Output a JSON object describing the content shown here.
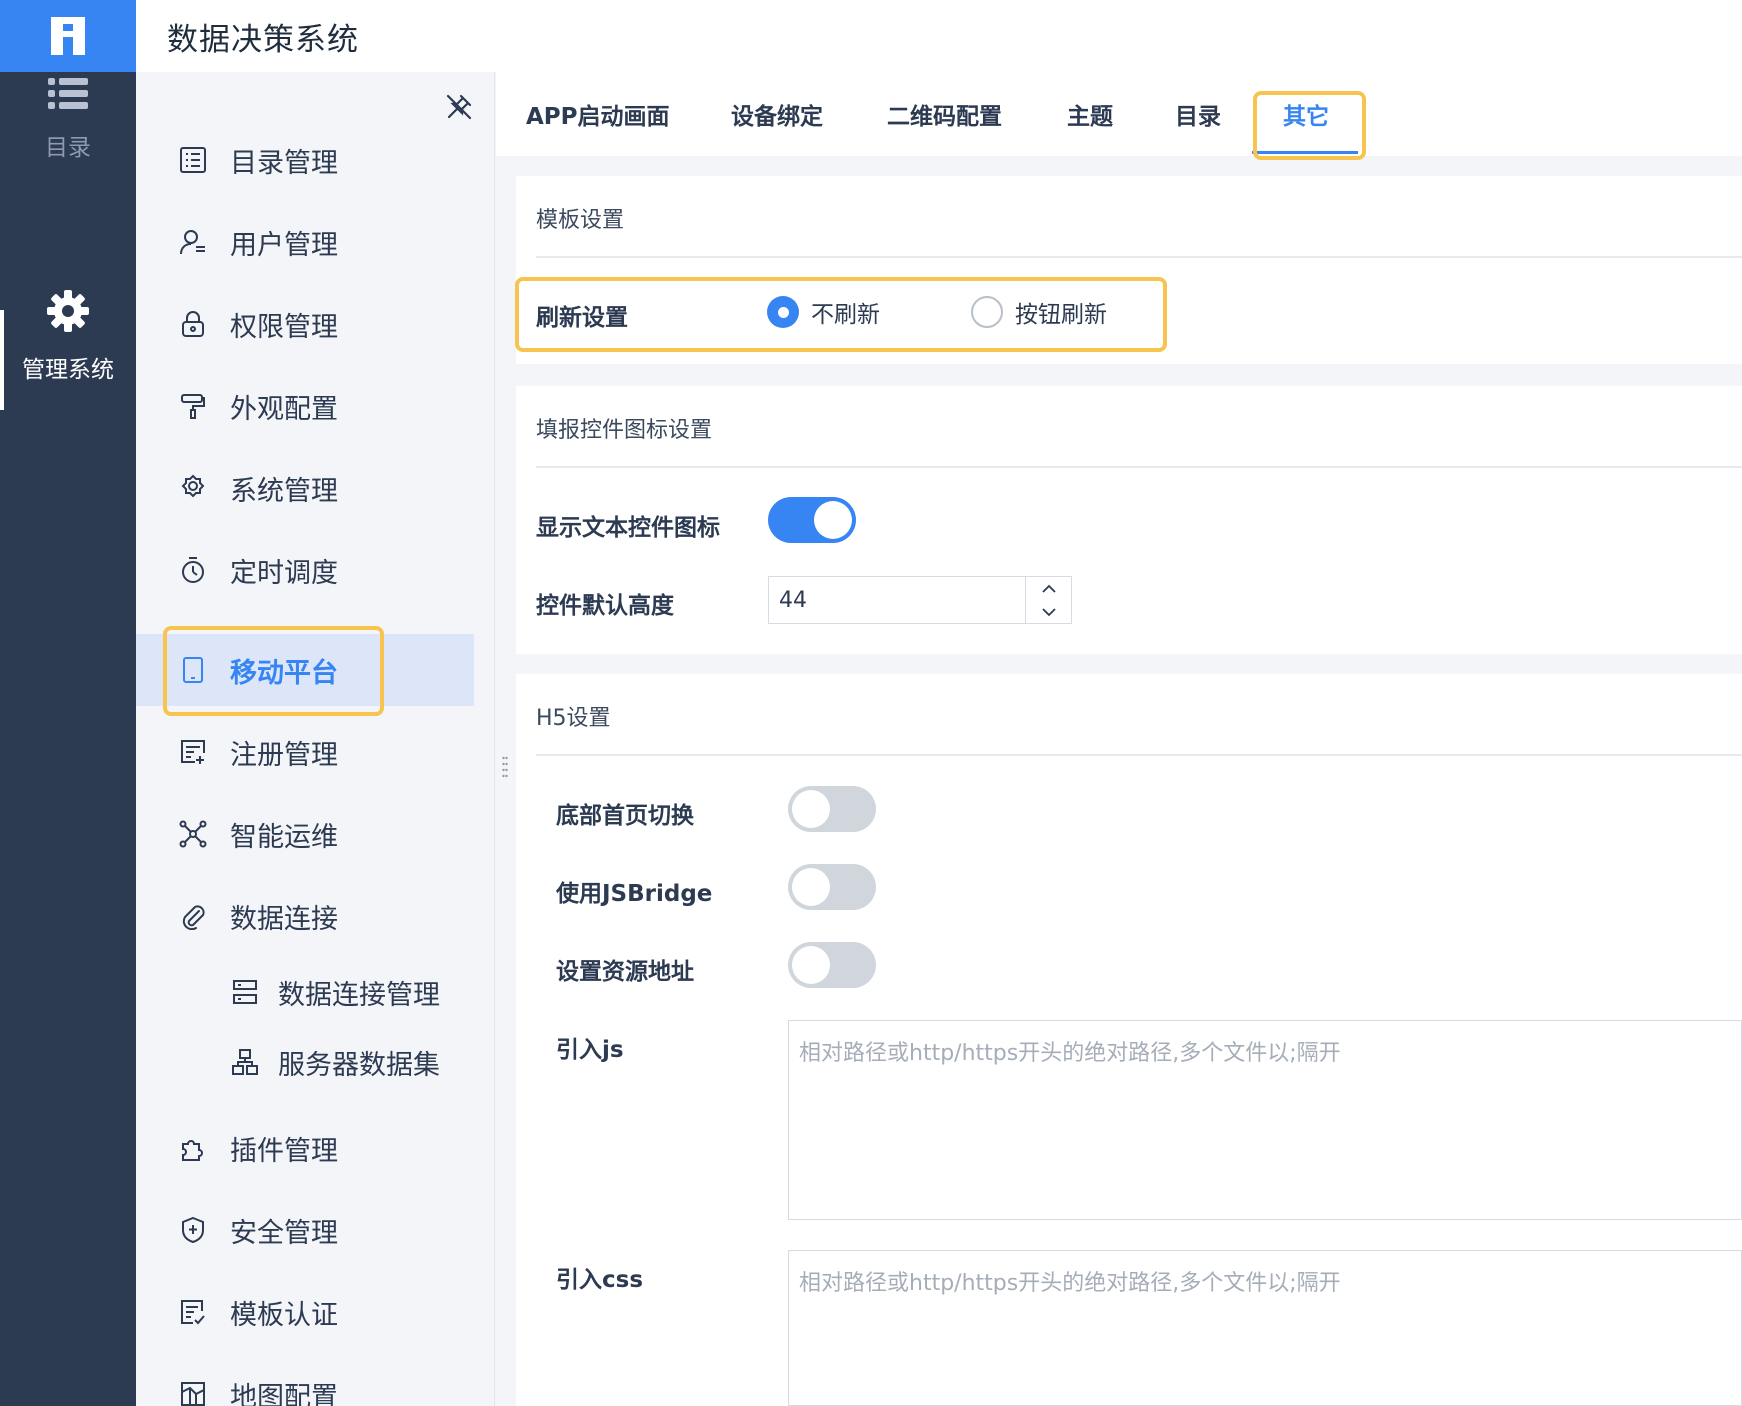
{
  "app": {
    "title": "数据决策系统",
    "logo_icon": "fanruan-logo-icon"
  },
  "rail": {
    "items": [
      {
        "label": "目录",
        "icon": "list-icon"
      },
      {
        "label": "管理系统",
        "icon": "gear-icon"
      }
    ]
  },
  "nav": {
    "items": [
      {
        "label": "目录管理",
        "icon": "directory-icon"
      },
      {
        "label": "用户管理",
        "icon": "user-icon"
      },
      {
        "label": "权限管理",
        "icon": "lock-icon"
      },
      {
        "label": "外观配置",
        "icon": "paint-roller-icon"
      },
      {
        "label": "系统管理",
        "icon": "gear-icon"
      },
      {
        "label": "定时调度",
        "icon": "stopwatch-icon"
      },
      {
        "label": "移动平台",
        "icon": "tablet-icon",
        "active": true
      },
      {
        "label": "注册管理",
        "icon": "register-icon"
      },
      {
        "label": "智能运维",
        "icon": "network-icon"
      },
      {
        "label": "数据连接",
        "icon": "paperclip-icon"
      },
      {
        "label": "插件管理",
        "icon": "puzzle-icon"
      },
      {
        "label": "安全管理",
        "icon": "shield-icon"
      },
      {
        "label": "模板认证",
        "icon": "template-cert-icon"
      },
      {
        "label": "地图配置",
        "icon": "map-icon"
      }
    ],
    "sub_items": [
      {
        "label": "数据连接管理",
        "icon": "server-icon"
      },
      {
        "label": "服务器数据集",
        "icon": "dataset-icon"
      }
    ]
  },
  "tabs": [
    "APP启动画面",
    "设备绑定",
    "二维码配置",
    "主题",
    "目录",
    "其它"
  ],
  "active_tab": "其它",
  "template_settings": {
    "title": "模板设置",
    "refresh_label": "刷新设置",
    "options": [
      "不刷新",
      "按钮刷新"
    ],
    "selected": "不刷新"
  },
  "widget_settings": {
    "title": "填报控件图标设置",
    "show_icon_label": "显示文本控件图标",
    "show_icon_on": true,
    "height_label": "控件默认高度",
    "height_value": "44"
  },
  "h5_settings": {
    "title": "H5设置",
    "bottom_switch_label": "底部首页切换",
    "bottom_switch_on": false,
    "jsbridge_label": "使用JSBridge",
    "jsbridge_on": false,
    "resource_label": "设置资源地址",
    "resource_on": false,
    "js_label": "引入js",
    "js_placeholder": "相对路径或http/https开头的绝对路径,多个文件以;隔开",
    "css_label": "引入css",
    "css_placeholder": "相对路径或http/https开头的绝对路径,多个文件以;隔开"
  },
  "colors": {
    "accent": "#3685f2",
    "rail": "#2c3a52",
    "highlight": "#f7c450",
    "active_bg": "#dce6f8"
  }
}
